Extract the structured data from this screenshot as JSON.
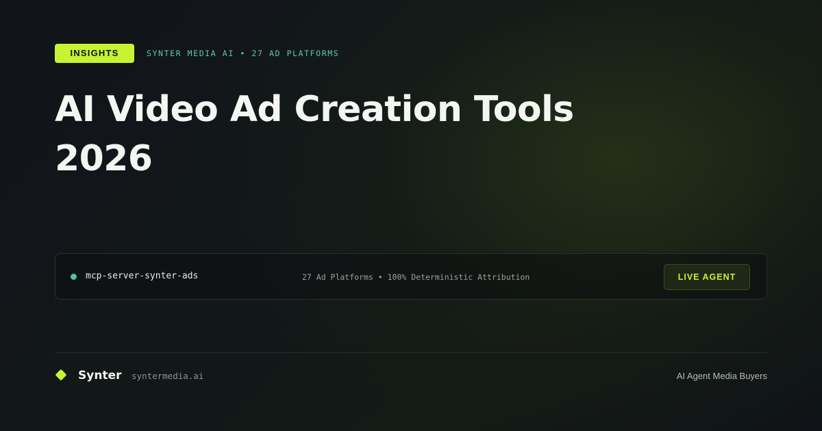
{
  "badge": {
    "label": "INSIGHTS"
  },
  "meta": {
    "text": "SYNTER MEDIA AI • 27 AD PLATFORMS"
  },
  "headline": {
    "line1": "AI Video Ad Creation Tools",
    "line2": "2026"
  },
  "card": {
    "server_name": "mcp-server-synter-ads",
    "stats": "27 Ad Platforms • 100% Deterministic Attribution",
    "button_label": "LIVE AGENT",
    "status_color": "#4fc3a6"
  },
  "footer": {
    "logo_icon": "diamond-logo-icon",
    "brand": "Synter",
    "domain": "syntermedia.ai",
    "tagline": "AI Agent Media Buyers"
  },
  "colors": {
    "accent": "#c6f432",
    "teal": "#5fc7b0",
    "background": "#11141b"
  }
}
